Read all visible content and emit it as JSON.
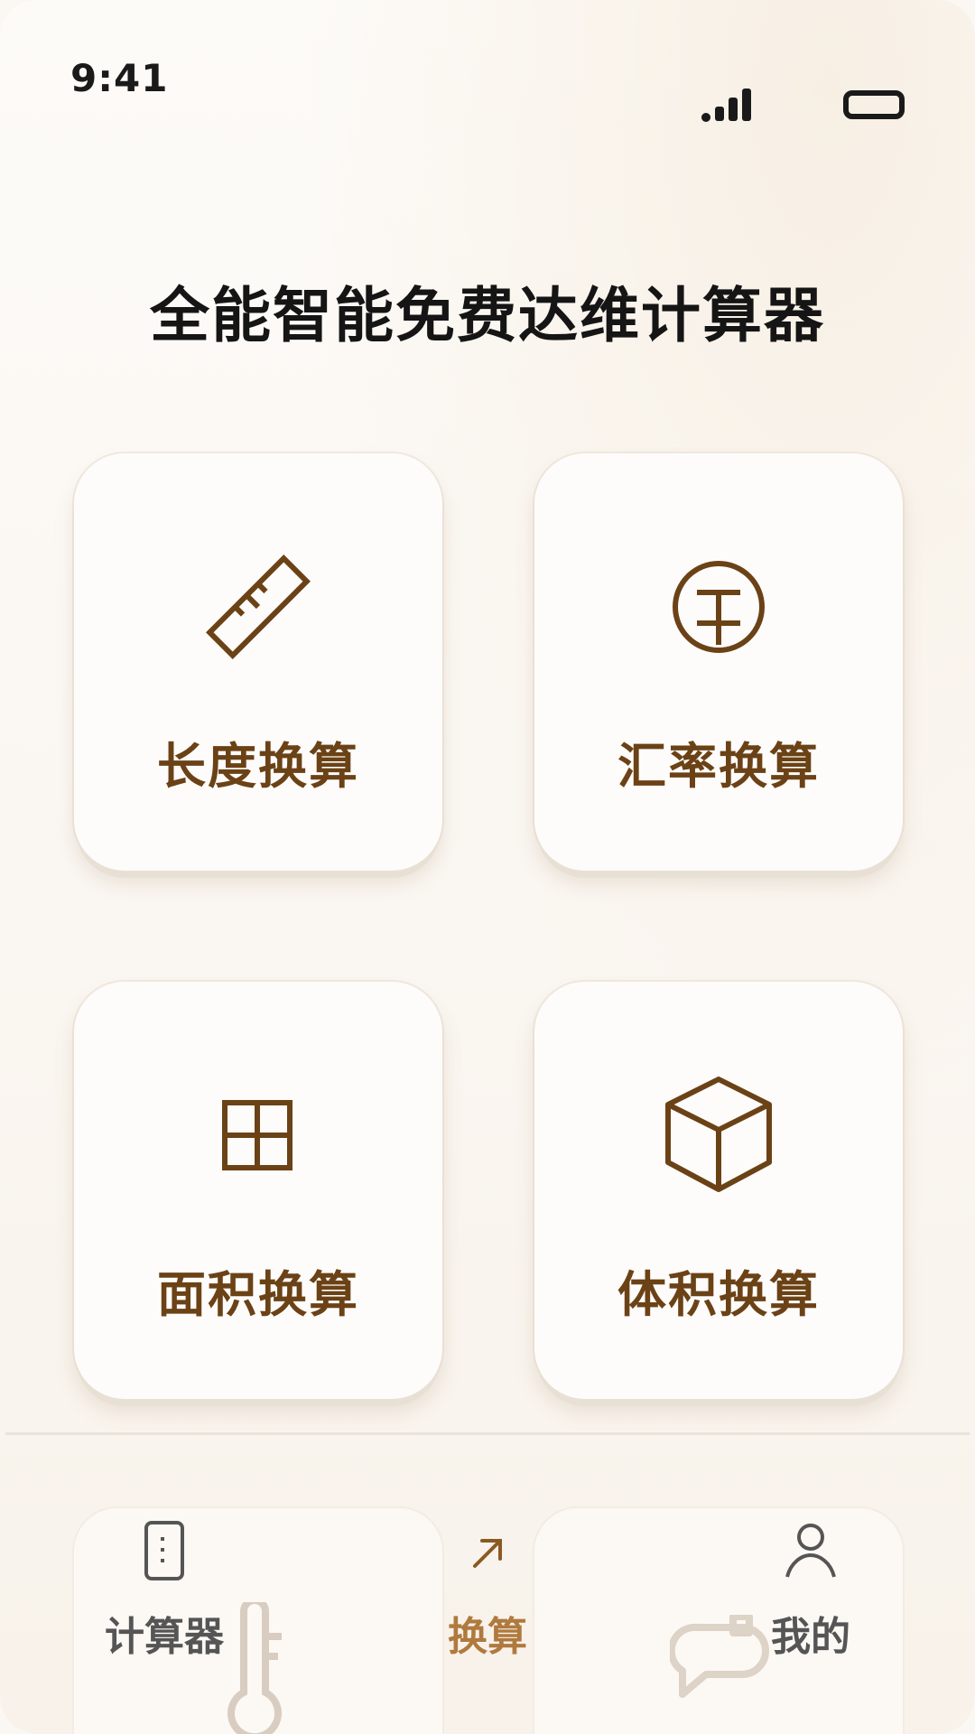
{
  "status_bar": {
    "time": "9:41"
  },
  "app": {
    "title": "全能智能免费达维计算器"
  },
  "cards": [
    {
      "label": "长度换算",
      "icon": "ruler-icon"
    },
    {
      "label": "汇率换算",
      "icon": "currency-icon"
    },
    {
      "label": "面积换算",
      "icon": "grid-icon"
    },
    {
      "label": "体积换算",
      "icon": "cube-icon"
    }
  ],
  "tabbar": {
    "items": [
      {
        "label": "计算器",
        "icon": "calculator-icon",
        "active": false
      },
      {
        "label": "换算",
        "icon": "arrow-up-right-icon",
        "active": true
      },
      {
        "label": "我的",
        "icon": "user-icon",
        "active": false
      }
    ]
  },
  "colors": {
    "accent": "#6b4216",
    "active_tab": "#b07a3e",
    "inactive_tab": "#555555",
    "title": "#151515"
  }
}
